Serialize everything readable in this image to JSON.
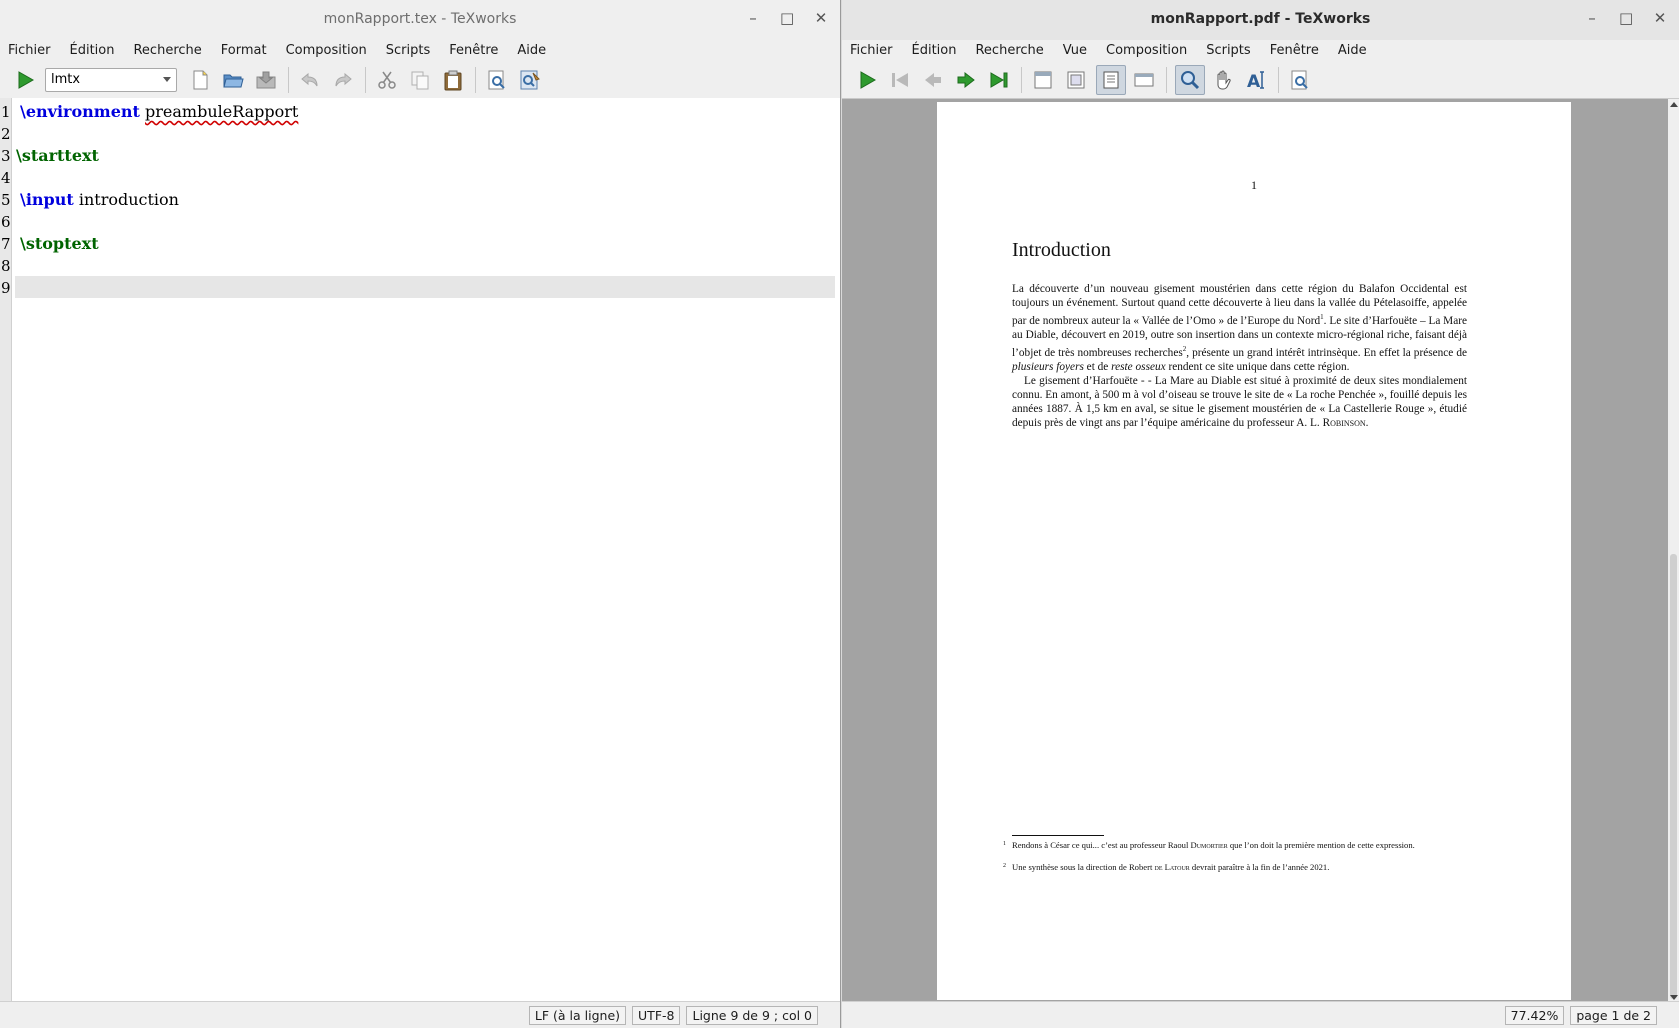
{
  "editor": {
    "title": "monRapport.tex - TeXworks",
    "menu": [
      "Fichier",
      "Édition",
      "Recherche",
      "Format",
      "Composition",
      "Scripts",
      "Fenêtre",
      "Aide"
    ],
    "engine": "lmtx",
    "lines": [
      {
        "num": "1",
        "cmd": "\\environment",
        "arg": "preambuleRapport"
      },
      {
        "num": "2"
      },
      {
        "num": "3",
        "cmd": "\\starttext"
      },
      {
        "num": "4"
      },
      {
        "num": "5",
        "cmd": "\\input",
        "arg": "introduction"
      },
      {
        "num": "6"
      },
      {
        "num": "7",
        "cmd": "\\stoptext"
      },
      {
        "num": "8"
      },
      {
        "num": "9"
      }
    ],
    "status": {
      "eol": "LF (à la ligne)",
      "encoding": "UTF-8",
      "position": "Ligne 9 de 9 ; col 0"
    }
  },
  "viewer": {
    "title": "monRapport.pdf - TeXworks",
    "menu": [
      "Fichier",
      "Édition",
      "Recherche",
      "Vue",
      "Composition",
      "Scripts",
      "Fenêtre",
      "Aide"
    ],
    "status": {
      "zoom": "77.42%",
      "page": "page 1 de 2"
    },
    "page": {
      "number": "1",
      "heading": "Introduction",
      "p1_a": "La découverte d’un nouveau gisement moustérien dans cette région du Balafon Occidental est toujours un événement. Surtout quand cette découverte à lieu dans la vallée du Pételasoiffe, appelée par de nombreux auteur la « Vallée de l’Omo » de l’Europe du Nord",
      "p1_fn1": "1",
      "p1_b": ". Le site d’Harfouëte – La Mare au Diable, découvert en 2019, outre son insertion dans un contexte micro-régional riche, faisant déjà l’objet de très nombreuses recherches",
      "p1_fn2": "2",
      "p1_c": ", présente un grand intérêt intrinsèque. En effet la présence de ",
      "p1_em1": "plusieurs foyers",
      "p1_d": " et de ",
      "p1_em2": "reste osseux",
      "p1_e": " rendent ce site unique dans cette région.",
      "p2_a": "Le gisement d’Harfouëte - - La Mare au Diable est situé à proximité de deux sites mondialement connu. En amont, à 500 m à vol d’oiseau se trouve le site de « La roche Penchée », fouillé depuis les années 1887. À 1,5 km en aval, se situe le gisement moustérien de « La Castellerie Rouge », étudié depuis près de vingt ans par l’équipe américaine du professeur A. L. ",
      "p2_sc": "Robinson",
      "p2_end": ".",
      "footnotes": [
        {
          "mark": "1",
          "pre": "Rendons à César ce qui... c’est au professeur Raoul ",
          "sc": "Dumortier",
          "post": " que l’on doit la première mention de cette expression."
        },
        {
          "mark": "2",
          "pre": "Une synthèse sous la direction de Robert ",
          "sc": "de Latour",
          "post": " devrait paraître à la fin de l’année 2021."
        }
      ]
    }
  },
  "icons": {
    "typeset": "play-icon",
    "accent_green": "#2e9a2e",
    "keyword_blue": "#0000dd",
    "keyword_green": "#006400"
  }
}
